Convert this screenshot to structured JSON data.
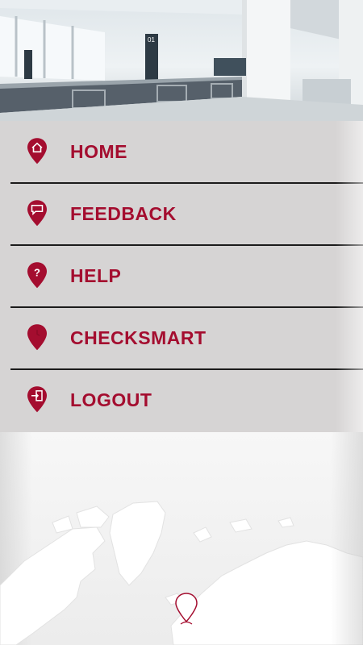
{
  "theme": {
    "accent": "#a40d2f",
    "menu_bg": "#d6d4d4",
    "divider": "#1b1b1b"
  },
  "hero": {
    "image": "airport-baggage-claim-photo"
  },
  "menu": {
    "items": [
      {
        "label": "HOME",
        "icon": "home-pin-icon"
      },
      {
        "label": "FEEDBACK",
        "icon": "speech-bubble-pin-icon"
      },
      {
        "label": "HELP",
        "icon": "question-pin-icon"
      },
      {
        "label": "CHECKSMART",
        "icon": "clock-pin-icon"
      },
      {
        "label": "LOGOUT",
        "icon": "logout-pin-icon"
      }
    ]
  },
  "map": {
    "image": "world-map",
    "marker": "location-marker-icon"
  }
}
